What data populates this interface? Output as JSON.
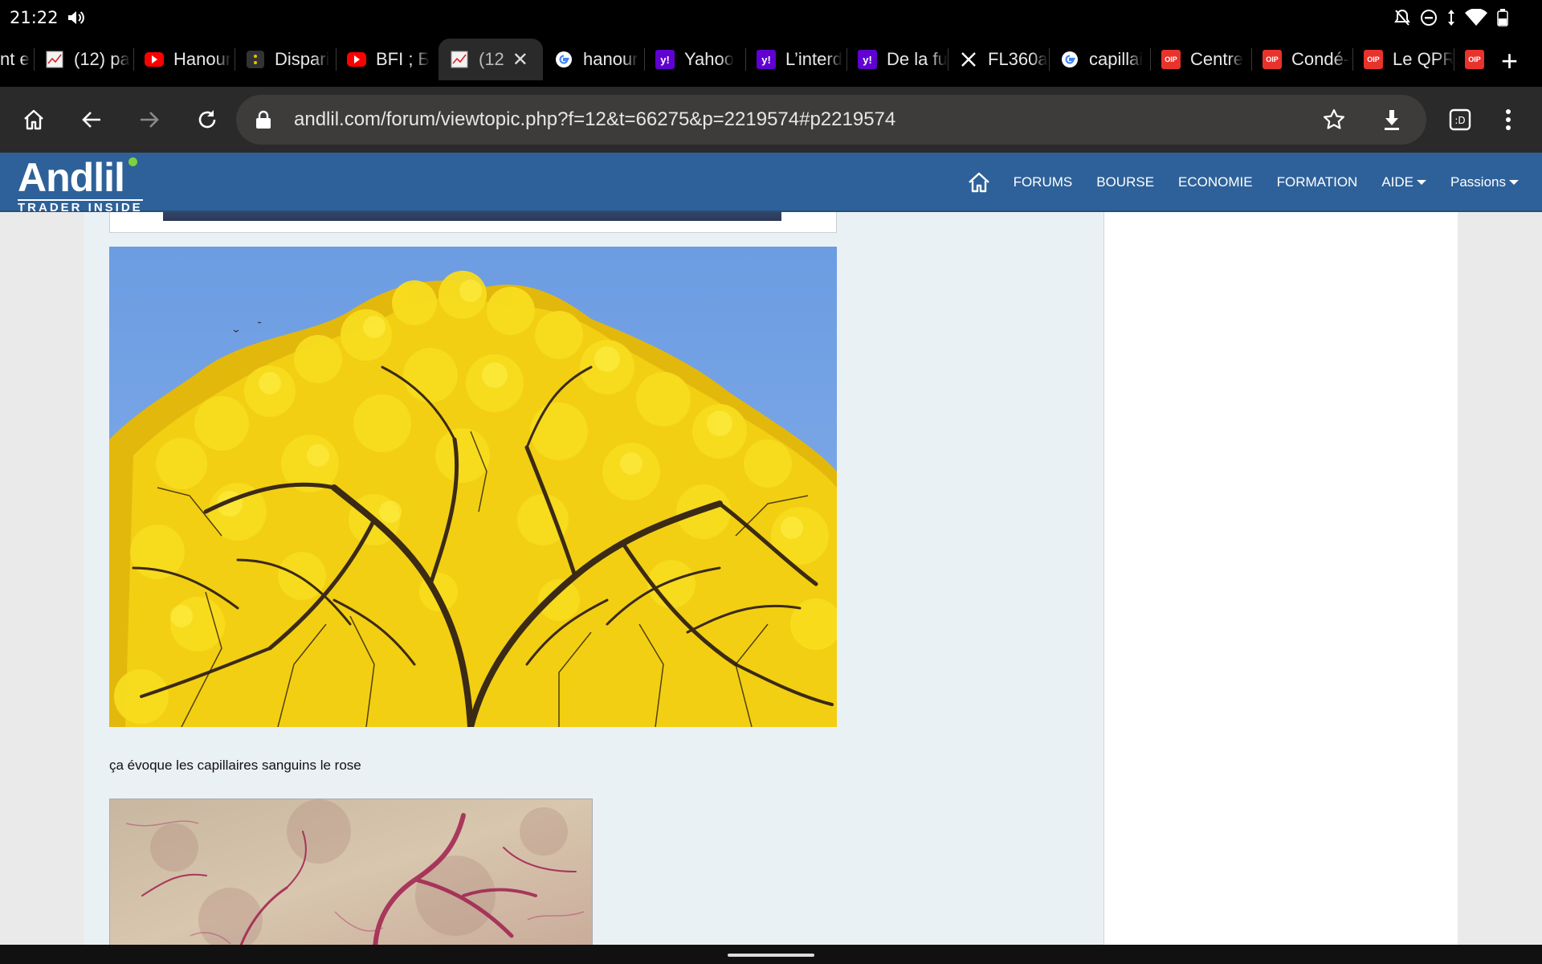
{
  "status": {
    "time": "21:22"
  },
  "tabs": [
    {
      "title": "nt e",
      "favicon": "page-icon"
    },
    {
      "title": "(12) pa",
      "favicon": "chart-icon"
    },
    {
      "title": "Hanour",
      "favicon": "youtube-icon"
    },
    {
      "title": "Dispari",
      "favicon": "app-icon"
    },
    {
      "title": "BFI ; Б",
      "favicon": "youtube-icon"
    },
    {
      "title": "(12",
      "favicon": "chart-icon",
      "active": true
    },
    {
      "title": "hanour",
      "favicon": "google-icon"
    },
    {
      "title": "Yahoo",
      "favicon": "yahoo-icon"
    },
    {
      "title": "L’interd",
      "favicon": "yahoo-icon"
    },
    {
      "title": "De la fu",
      "favicon": "yahoo-icon"
    },
    {
      "title": "FL360a",
      "favicon": "x-icon"
    },
    {
      "title": "capillai",
      "favicon": "google-icon"
    },
    {
      "title": "Centre",
      "favicon": "oip-icon"
    },
    {
      "title": "Condé-",
      "favicon": "oip-icon"
    },
    {
      "title": "Le QPR",
      "favicon": "oip-icon"
    },
    {
      "title": "",
      "favicon": "oip-icon"
    }
  ],
  "oip_label": "OIP",
  "toolbar": {
    "url": "andlil.com/forum/viewtopic.php?f=12&t=66275&p=2219574#p2219574"
  },
  "site": {
    "logo_word": "Andlil",
    "logo_tagline": "TRADER INSIDE",
    "nav": {
      "forums": "FORUMS",
      "bourse": "BOURSE",
      "economie": "ECONOMIE",
      "formation": "FORMATION",
      "aide": "AIDE",
      "passions": "Passions"
    }
  },
  "post": {
    "caption": "ça évoque les capillaires sanguins le rose"
  },
  "colors": {
    "site_nav": "#2e6199",
    "post_bg": "#eaf1f5",
    "flowers": "#f6d516",
    "sky": "#6f9de0"
  }
}
